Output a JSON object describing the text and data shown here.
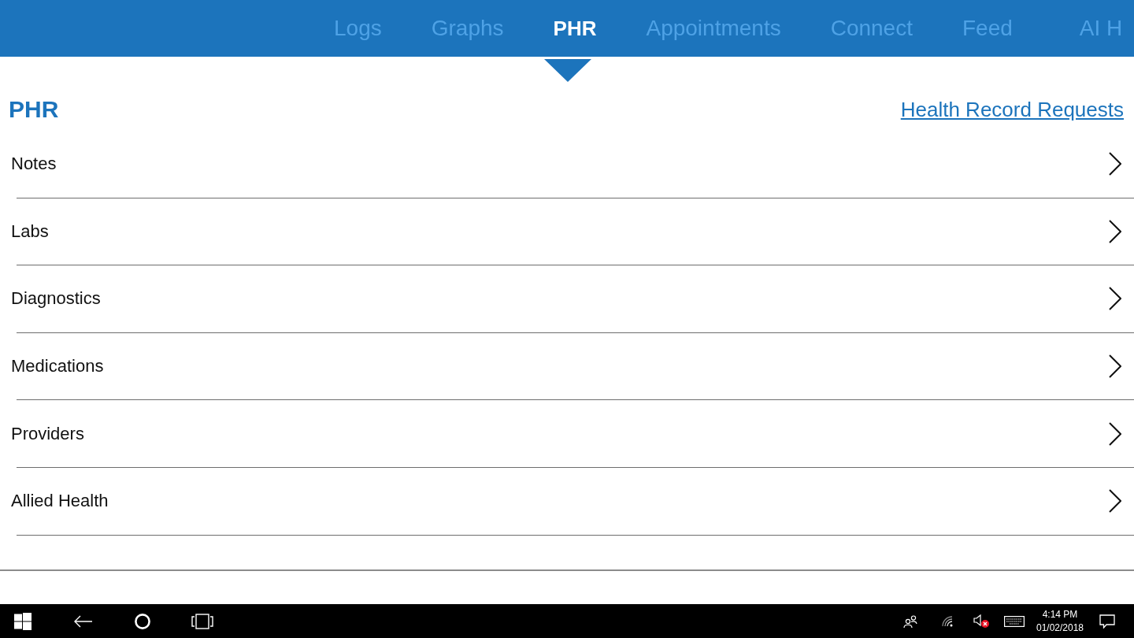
{
  "nav": {
    "tabs": [
      {
        "label": "Logs",
        "selected": false
      },
      {
        "label": "Graphs",
        "selected": false
      },
      {
        "label": "PHR",
        "selected": true
      },
      {
        "label": "Appointments",
        "selected": false
      },
      {
        "label": "Connect",
        "selected": false
      },
      {
        "label": "Feed",
        "selected": false
      },
      {
        "label": "AI H",
        "selected": false
      }
    ]
  },
  "page": {
    "title": "PHR",
    "link": "Health Record Requests"
  },
  "list": {
    "items": [
      {
        "label": "Notes"
      },
      {
        "label": "Labs"
      },
      {
        "label": "Diagnostics"
      },
      {
        "label": "Medications"
      },
      {
        "label": "Providers"
      },
      {
        "label": "Allied Health"
      }
    ]
  },
  "taskbar": {
    "volume": {
      "muted": true
    },
    "clock": {
      "time": "4:14 PM",
      "date": "01/02/2018"
    }
  }
}
